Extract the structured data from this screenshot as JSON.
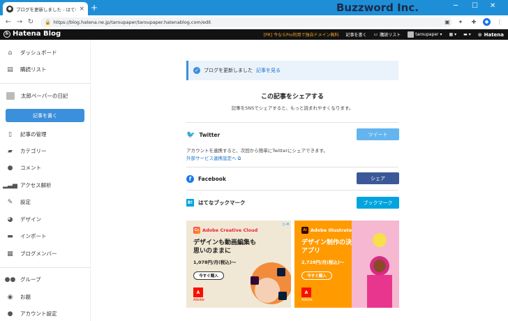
{
  "browser": {
    "tab_title": "ブログを更新しました - はてなブログ",
    "url": "https://blog.hatena.ne.jp/taroupaper/taroupaper.hatenablog.com/edit",
    "watermark": "Buzzword Inc."
  },
  "header": {
    "logo": "Hatena Blog",
    "pro_promo": "[PR] 今ならPro利用で独自ドメイン無料",
    "write": "記事を書く",
    "reader": "購読リスト",
    "user": "taroupaper",
    "hatena": "Hatena"
  },
  "sidebar": {
    "dashboard": "ダッシュボード",
    "subscriptions": "購読リスト",
    "blog_name": "太郎ペーパーの日記",
    "write_button": "記事を書く",
    "items": [
      {
        "label": "記事の管理",
        "icon": "document-icon"
      },
      {
        "label": "カテゴリー",
        "icon": "folder-icon"
      },
      {
        "label": "コメント",
        "icon": "comment-icon"
      },
      {
        "label": "アクセス解析",
        "icon": "chart-icon"
      },
      {
        "label": "設定",
        "icon": "wrench-icon"
      },
      {
        "label": "デザイン",
        "icon": "palette-icon"
      },
      {
        "label": "インポート",
        "icon": "truck-icon"
      },
      {
        "label": "ブログメンバー",
        "icon": "members-icon"
      }
    ],
    "groups": "グループ",
    "odai": "お題",
    "account": "アカウント設定"
  },
  "main": {
    "success_message": "ブログを更新しました",
    "success_link": "記事を見る",
    "share_title": "この記事をシェアする",
    "share_sub": "記事をSNSでシェアすると、もっと読まれやすくなります。",
    "twitter": {
      "label": "Twitter",
      "button": "ツイート",
      "desc": "アカウントを連携すると、次回から簡単にTwitterにシェアできます。",
      "link": "外部サービス連携設定へ"
    },
    "facebook": {
      "label": "Facebook",
      "button": "シェア"
    },
    "hatebu": {
      "label": "はてなブックマーク",
      "button": "ブックマーク",
      "icon_text": "B!"
    }
  },
  "ads": [
    {
      "brand": "Adobe Creative Cloud",
      "logo_text": "Cc",
      "headline": "デザインも動画編集も思いのままに",
      "price": "1,078円/月(税込)～",
      "cta": "今すぐ購入",
      "adobe": "Adobe"
    },
    {
      "brand": "Adobe Illustrator",
      "logo_text": "Ai",
      "headline": "デザイン制作の決定版アプリ",
      "price": "2,728円/月(税込)～",
      "cta": "今すぐ購入",
      "adobe": "Adobe"
    }
  ]
}
